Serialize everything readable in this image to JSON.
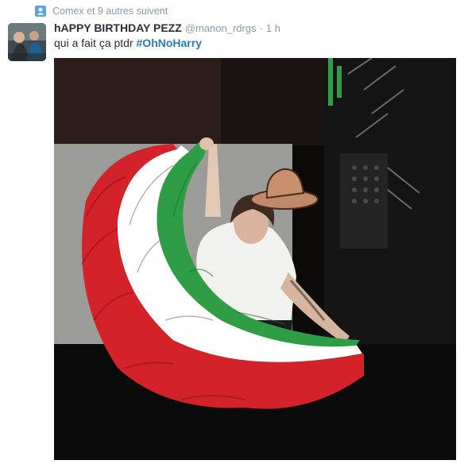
{
  "context": {
    "icon": "person-icon",
    "text": "Comex et 9 autres suivent"
  },
  "tweet": {
    "display_name": "hAPPY BIRTHDAY PEZZ",
    "handle": "@manon_rdrgs",
    "separator": "·",
    "time": "1 h",
    "text_prefix": "qui a fait ça ptdr ",
    "hashtag": "#OhNoHarry"
  },
  "colors": {
    "link": "#2b7bb9",
    "muted": "#8899a6",
    "text": "#292f33",
    "flag_green": "#2f9d45",
    "flag_white": "#ffffff",
    "flag_red": "#d3222a"
  }
}
